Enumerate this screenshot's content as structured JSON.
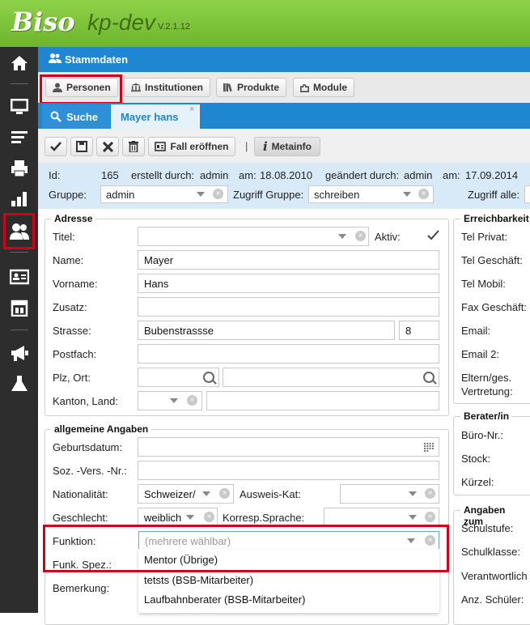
{
  "header": {
    "logo": "Biso",
    "app_name": "kp-dev",
    "version": "V.2.1.12"
  },
  "sidebar": {
    "items": [
      {
        "name": "home-icon",
        "glyph": "⌂"
      },
      {
        "name": "monitor-icon",
        "glyph": "▭"
      },
      {
        "name": "list-icon",
        "glyph": "≡"
      },
      {
        "name": "printer-icon",
        "glyph": "▤"
      },
      {
        "name": "bar-chart-icon",
        "glyph": "▮"
      },
      {
        "name": "users-icon",
        "glyph": "👥"
      },
      {
        "name": "id-card-icon",
        "glyph": "▣"
      },
      {
        "name": "calendar-icon",
        "glyph": "▦"
      },
      {
        "name": "megaphone-icon",
        "glyph": "📢"
      },
      {
        "name": "flask-icon",
        "glyph": "⚗"
      }
    ],
    "active": "users-icon"
  },
  "section_title": "Stammdaten",
  "nav": {
    "personen": "Personen",
    "institutionen": "Institutionen",
    "produkte": "Produkte",
    "module": "Module",
    "active": "Personen"
  },
  "tabs": {
    "suche": "Suche",
    "record": "Mayer hans",
    "close": "×"
  },
  "toolbar": {
    "fall_eroeffnen": "Fall eröffnen",
    "metainfo": "Metainfo",
    "separator": "|"
  },
  "info": {
    "id_label": "Id:",
    "id_value": "165",
    "created_by_label": "erstellt durch:",
    "created_by": "admin",
    "created_on_label": "am:",
    "created_on": "18.08.2010",
    "changed_by_label": "geändert durch:",
    "changed_by": "admin",
    "changed_on_label": "am:",
    "changed_on": "17.09.2014",
    "gruppe_label": "Gruppe:",
    "gruppe_value": "admin",
    "zugriff_gruppe_label": "Zugriff Gruppe:",
    "zugriff_gruppe_value": "schreiben",
    "zugriff_alle_label": "Zugriff alle:"
  },
  "adresse": {
    "legend": "Adresse",
    "titel_label": "Titel:",
    "titel_value": "",
    "aktiv_label": "Aktiv:",
    "aktiv_checked": true,
    "name_label": "Name:",
    "name_value": "Mayer",
    "vorname_label": "Vorname:",
    "vorname_value": "Hans",
    "zusatz_label": "Zusatz:",
    "zusatz_value": "",
    "strasse_label": "Strasse:",
    "strasse_value": "Bubenstrassse",
    "hausnr_value": "8",
    "postfach_label": "Postfach:",
    "postfach_value": "",
    "plz_ort_label": "Plz, Ort:",
    "kanton_land_label": "Kanton, Land:"
  },
  "erreichbarkeit": {
    "legend": "Erreichbarkeit",
    "labels": [
      "Tel Privat:",
      "Tel Geschäft:",
      "Tel Mobil:",
      "Fax Geschäft:",
      "Email:",
      "Email 2:",
      "Eltern/ges.",
      "Vertretung:"
    ]
  },
  "allgemein": {
    "legend": "allgemeine Angaben",
    "geburtsdatum_label": "Geburtsdatum:",
    "sozvers_label": "Soz. -Vers. -Nr.:",
    "nationalitaet_label": "Nationalität:",
    "nationalitaet_value": "Schweizer/",
    "ausweis_label": "Ausweis-Kat:",
    "geschlecht_label": "Geschlecht:",
    "geschlecht_value": "weiblich",
    "korresp_label": "Korresp.Sprache:",
    "funktion_label": "Funktion:",
    "funktion_placeholder": "(mehrere wählbar)",
    "funk_spez_label": "Funk. Spez.:",
    "bemerkung_label": "Bemerkung:",
    "funktion_options": [
      "Mentor (Übrige)",
      "tetsts (BSB-Mitarbeiter)",
      "Laufbahnberater (BSB-Mitarbeiter)"
    ]
  },
  "berater": {
    "legend": "Berater/in",
    "labels": [
      "Büro-Nr.:",
      "Stock:",
      "Kürzel:"
    ]
  },
  "angaben_zum": {
    "legend": "Angaben zum",
    "labels": [
      "Schulstufe:",
      "Schulklasse:",
      "Verantwortlich",
      "Anz. Schüler:"
    ]
  },
  "colors": {
    "brand_green": "#7cc23a",
    "primary_blue": "#1f86d1",
    "highlight_red": "#d0021b",
    "info_band": "#d8e9f7"
  }
}
